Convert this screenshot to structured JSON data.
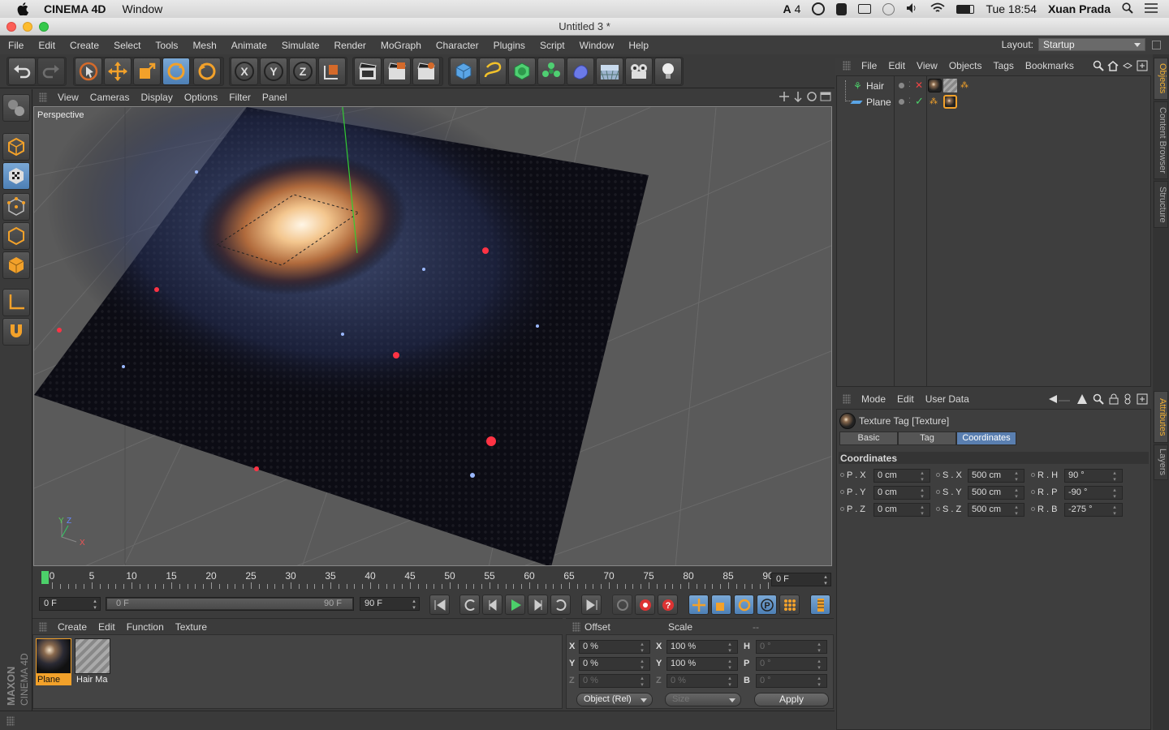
{
  "macbar": {
    "app_name": "CINEMA 4D",
    "menu_window": "Window",
    "badge": "4",
    "clock": "Tue 18:54",
    "user": "Xuan Prada"
  },
  "window": {
    "title": "Untitled 3 *"
  },
  "menu": [
    "File",
    "Edit",
    "Create",
    "Select",
    "Tools",
    "Mesh",
    "Animate",
    "Simulate",
    "Render",
    "MoGraph",
    "Character",
    "Plugins",
    "Script",
    "Window",
    "Help"
  ],
  "layout": {
    "label": "Layout:",
    "value": "Startup"
  },
  "viewport": {
    "menu": [
      "View",
      "Cameras",
      "Display",
      "Options",
      "Filter",
      "Panel"
    ],
    "camera_label": "Perspective",
    "axis_y": "Y",
    "axis_z": "Z",
    "axis_x": "X"
  },
  "timeline": {
    "ticks": [
      "0",
      "5",
      "10",
      "15",
      "20",
      "25",
      "30",
      "35",
      "40",
      "45",
      "50",
      "55",
      "60",
      "65",
      "70",
      "75",
      "80",
      "85",
      "90"
    ],
    "current_frame": "0 F"
  },
  "transport": {
    "start": "0 F",
    "range_start": "0 F",
    "range_end": "90 F",
    "end": "90 F"
  },
  "materials": {
    "menu": [
      "Create",
      "Edit",
      "Function",
      "Texture"
    ],
    "items": [
      {
        "label": "Plane"
      },
      {
        "label": "Hair Ma"
      }
    ]
  },
  "coords": {
    "col_offset": "Offset",
    "col_scale": "Scale",
    "col_rot": "--",
    "rows": [
      {
        "axis": "X",
        "offset": "0 %",
        "scale_axis": "X",
        "scale": "100 %",
        "rot_axis": "H",
        "rot": "0 °"
      },
      {
        "axis": "Y",
        "offset": "0 %",
        "scale_axis": "Y",
        "scale": "100 %",
        "rot_axis": "P",
        "rot": "0 °"
      },
      {
        "axis": "Z",
        "offset": "0 %",
        "scale_axis": "Z",
        "scale": "0 %",
        "rot_axis": "B",
        "rot": "0 °"
      }
    ],
    "mode": "Object (Rel)",
    "size": "Size",
    "apply": "Apply"
  },
  "objects": {
    "menu": [
      "File",
      "Edit",
      "View",
      "Objects",
      "Tags",
      "Bookmarks"
    ],
    "items": [
      {
        "name": "Hair"
      },
      {
        "name": "Plane"
      }
    ]
  },
  "side_tabs": [
    "Objects",
    "Content Browser",
    "Structure",
    "Attributes",
    "Layers"
  ],
  "attributes": {
    "menu": [
      "Mode",
      "Edit",
      "User Data"
    ],
    "title": "Texture Tag [Texture]",
    "tabs": [
      "Basic",
      "Tag",
      "Coordinates"
    ],
    "section": "Coordinates",
    "rows": [
      {
        "p": "P . X",
        "pv": "0 cm",
        "s": "S . X",
        "sv": "500 cm",
        "r": "R . H",
        "rv": "90 °"
      },
      {
        "p": "P . Y",
        "pv": "0 cm",
        "s": "S . Y",
        "sv": "500 cm",
        "r": "R . P",
        "rv": "-90 °"
      },
      {
        "p": "P . Z",
        "pv": "0 cm",
        "s": "S . Z",
        "sv": "500 cm",
        "r": "R . B",
        "rv": "-275 °"
      }
    ]
  },
  "brand": {
    "logo_text": "MAXON CINEMA 4D"
  }
}
